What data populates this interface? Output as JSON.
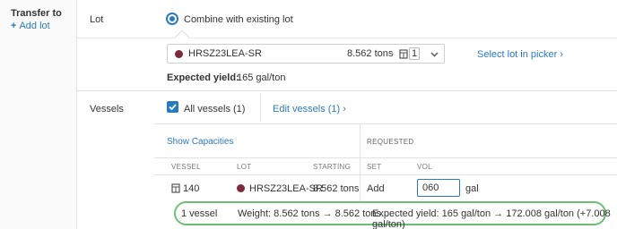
{
  "transfer": {
    "title": "Transfer to",
    "add_lot": "Add lot"
  },
  "lot": {
    "label": "Lot",
    "option_label": "Combine with existing lot",
    "selected": {
      "name": "HRSZ23LEA-SR",
      "tons": "8.562 tons",
      "separator": "-",
      "vessel_count": "1",
      "color": "#7a2a3a"
    },
    "picker_link": "Select lot in picker",
    "expected_yield_label": "Expected yield:",
    "expected_yield_value": "165 gal/ton"
  },
  "vessels": {
    "label": "Vessels",
    "all_vessels": "All vessels (1)",
    "edit_link": "Edit vessels (1)",
    "show_capacities": "Show Capacities",
    "requested_header": "REQUESTED",
    "columns": {
      "vessel": "VESSEL",
      "lot": "LOT",
      "starting": "STARTING",
      "set": "SET",
      "vol": "VOL"
    },
    "rows": [
      {
        "vessel": "140",
        "lot": "HRSZ23LEA-SR",
        "starting": "8.562 tons",
        "set": "Add",
        "vol": "060",
        "unit": "gal"
      }
    ]
  },
  "summary": {
    "vessel_count": "1 vessel",
    "weight": "Weight: 8.562 tons → 8.562 tons",
    "yield": "Expected yield: 165 gal/ton → 172.008 gal/ton (+7.008 gal/ton)"
  },
  "colors": {
    "accent": "#2a7ac0",
    "lot_dot": "#7a2a3a",
    "highlight": "#6dbf73"
  }
}
